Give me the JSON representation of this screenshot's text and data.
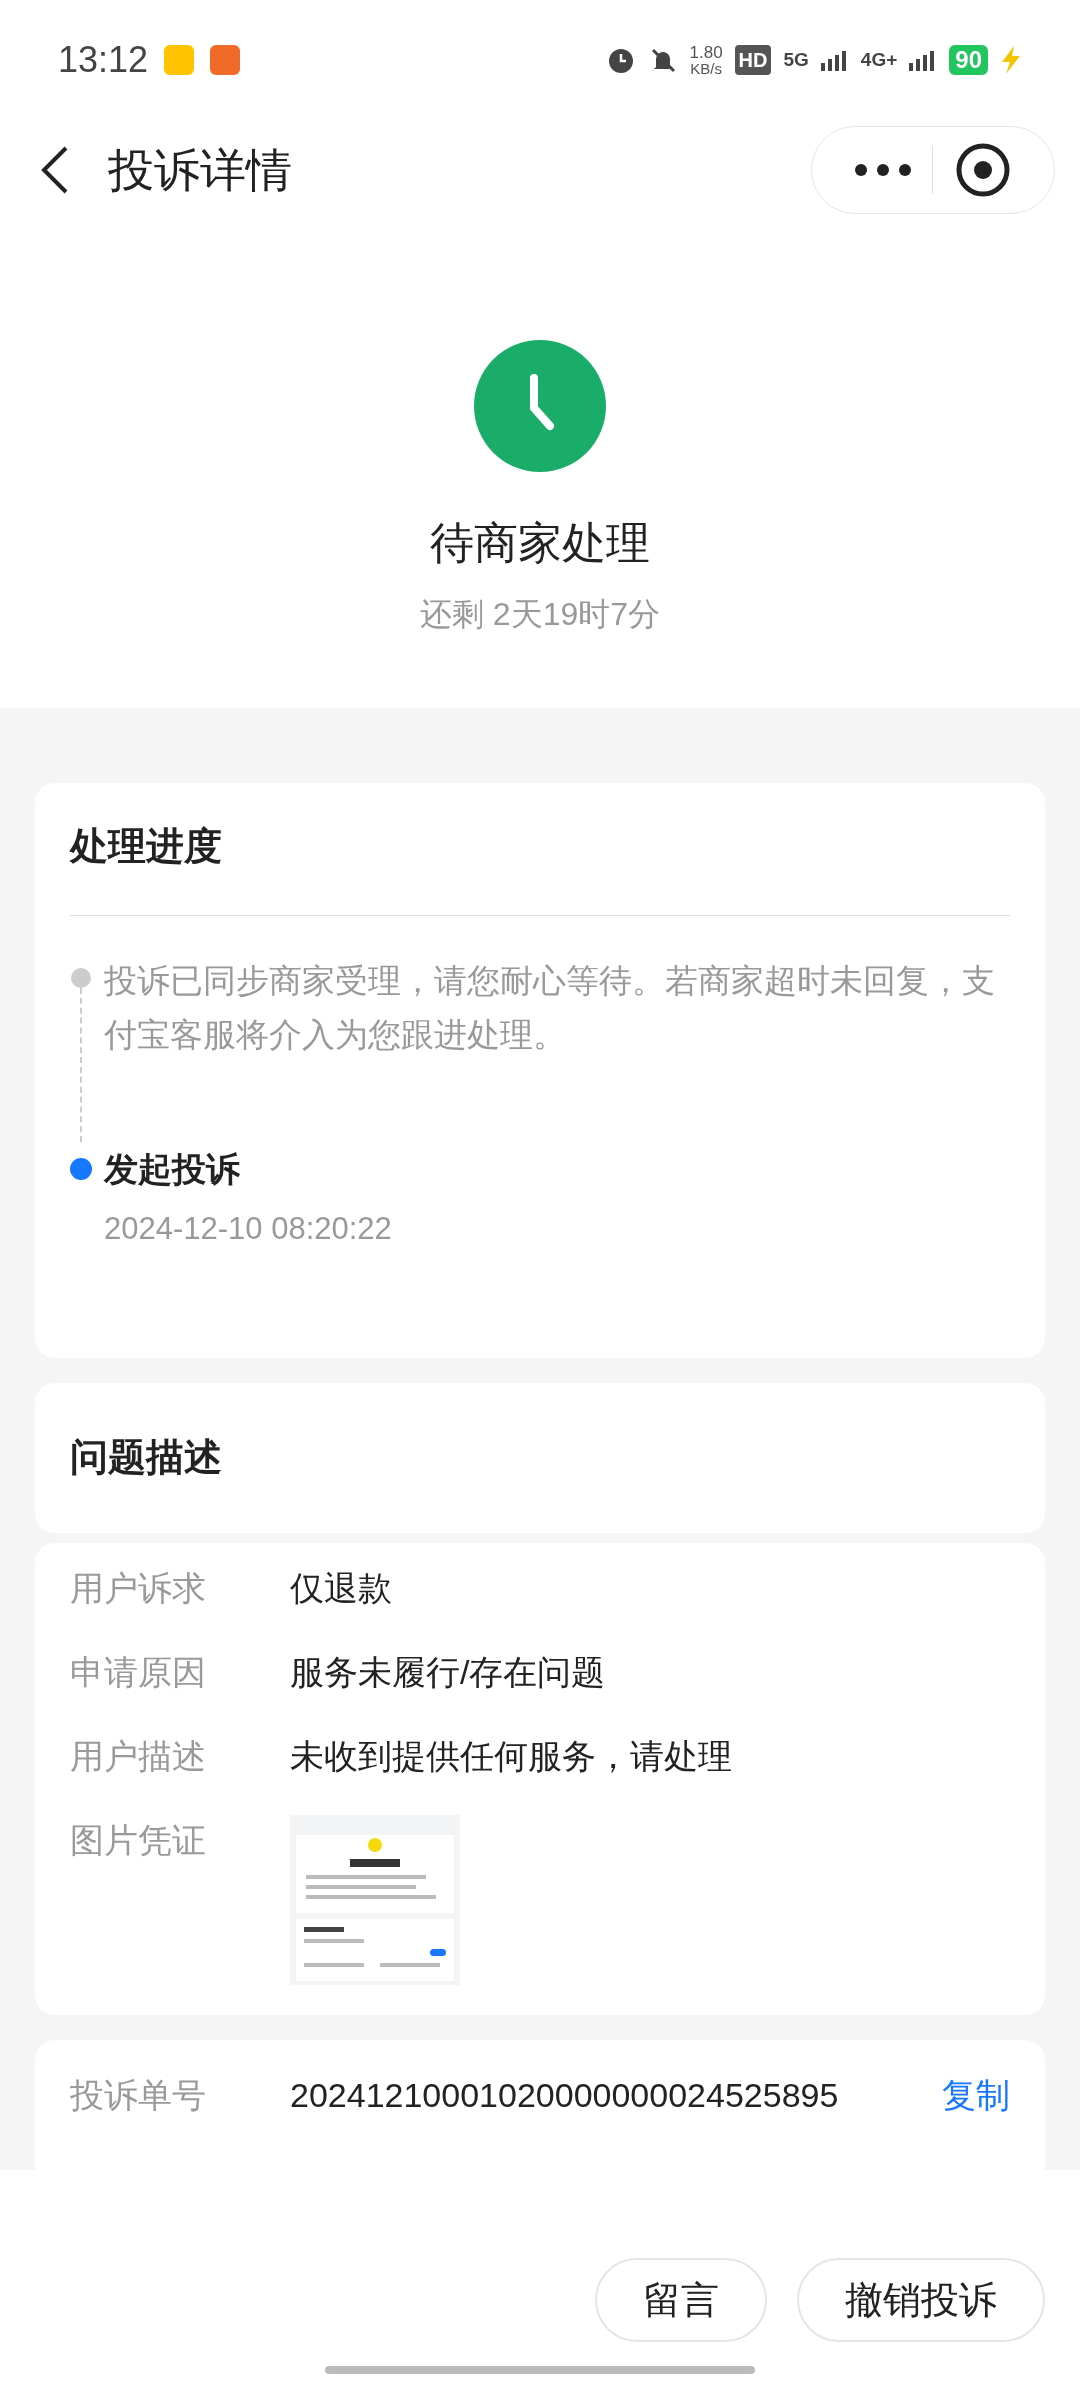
{
  "status_bar": {
    "time": "13:12",
    "net_speed": "1.80",
    "net_unit": "KB/s",
    "hd": "HD",
    "sim": "5G",
    "sim2": "4G+",
    "battery": "90"
  },
  "header": {
    "title": "投诉详情"
  },
  "status": {
    "title": "待商家处理",
    "countdown": "还剩 2天19时7分"
  },
  "progress": {
    "title": "处理进度",
    "steps": [
      {
        "text": "投诉已同步商家受理，请您耐心等待。若商家超时未回复，支付宝客服将介入为您跟进处理。",
        "active": false
      },
      {
        "text": "发起投诉",
        "time": "2024-12-10 08:20:22",
        "active": true
      }
    ]
  },
  "description": {
    "title": "问题描述",
    "rows": [
      {
        "kind": "text",
        "label": "用户诉求",
        "value": "仅退款"
      },
      {
        "kind": "text",
        "label": "申请原因",
        "value": "服务未履行/存在问题"
      },
      {
        "kind": "text",
        "label": "用户描述",
        "value": "未收到提供任何服务，请处理"
      },
      {
        "label": "图片凭证"
      }
    ]
  },
  "info": {
    "rows": [
      {
        "label": "投诉单号",
        "value": "20241210001020000000024525895",
        "action": "复制"
      }
    ]
  },
  "buttons": [
    "留言",
    "撤销投诉"
  ]
}
